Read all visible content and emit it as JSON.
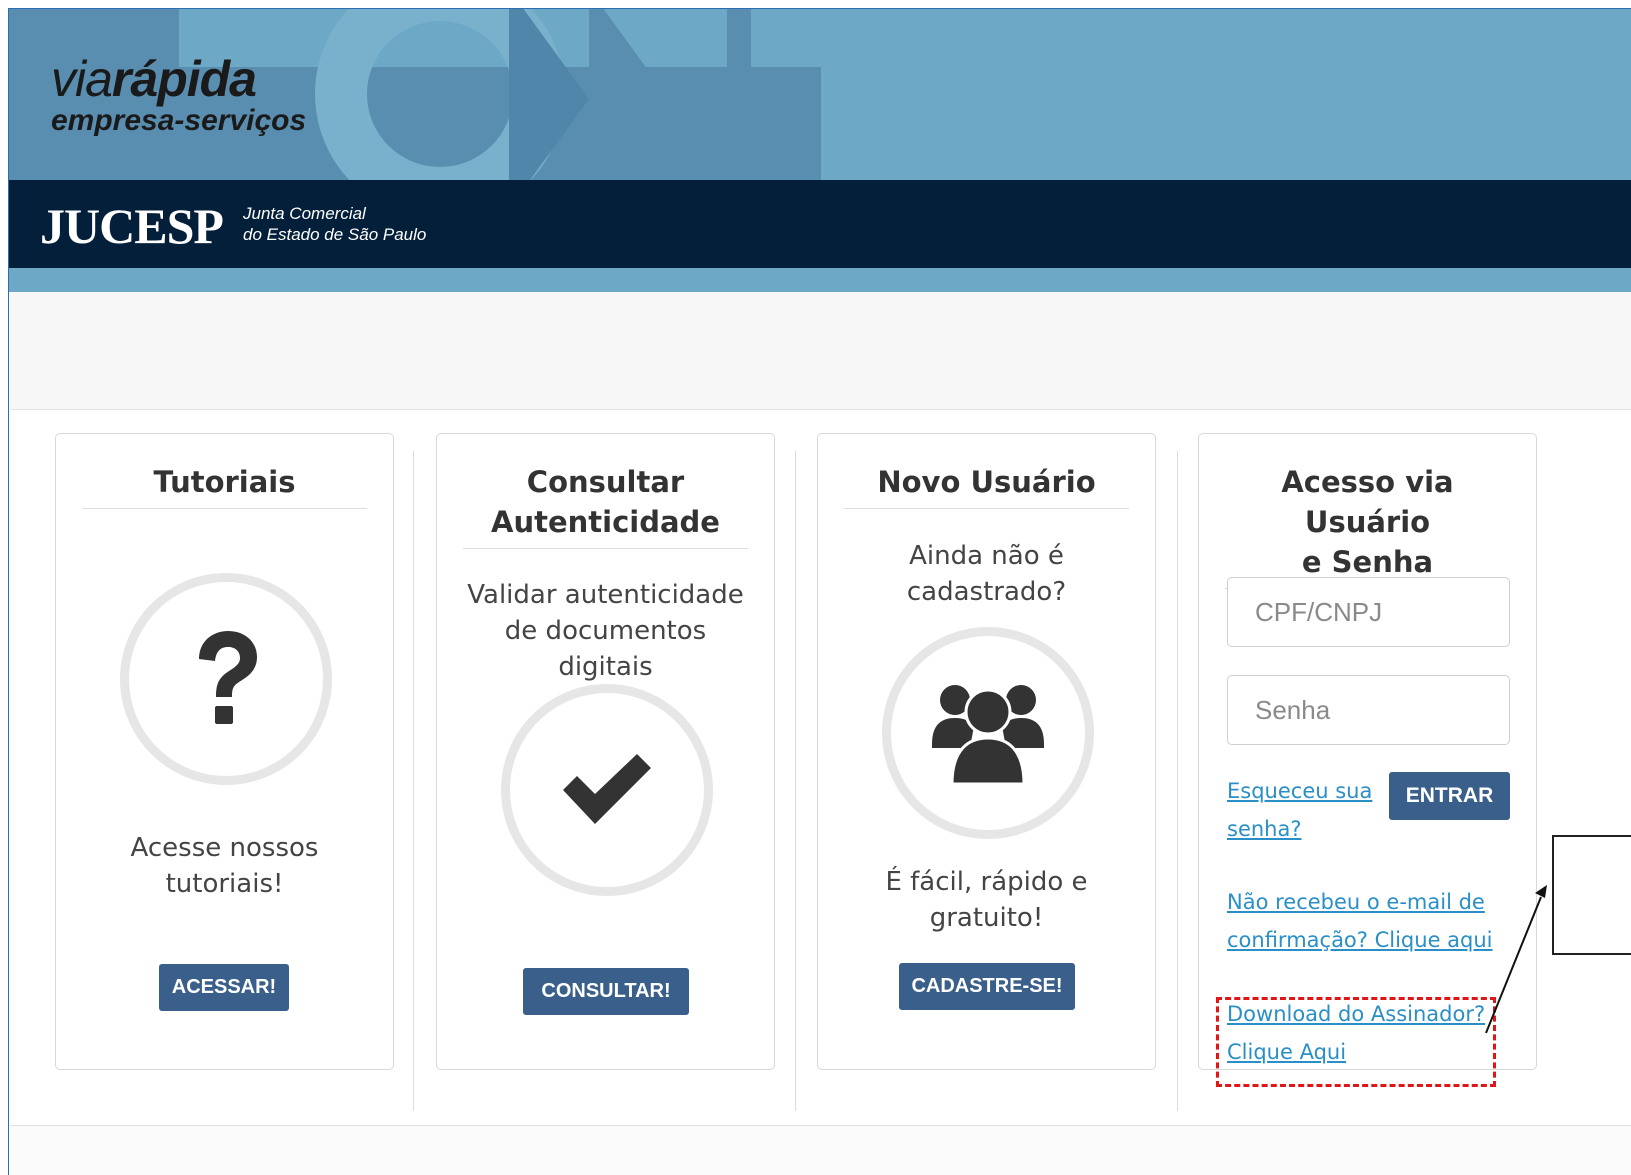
{
  "header": {
    "brand_via": "via",
    "brand_rapida": "rápida",
    "brand_sub": "empresa-serviços",
    "org_logo": "JUCESP",
    "org_line1": "Junta Comercial",
    "org_line2": "do Estado de São Paulo"
  },
  "cards": {
    "tutoriais": {
      "title": "Tutoriais",
      "icon": "question-icon",
      "text_line1": "Acesse nossos",
      "text_line2": "tutoriais!",
      "button": "ACESSAR!"
    },
    "consultar": {
      "title_line1": "Consultar",
      "title_line2": "Autenticidade",
      "text_line1": "Validar autenticidade",
      "text_line2": "de documentos",
      "text_line3": "digitais",
      "icon": "check-icon",
      "button": "CONSULTAR!"
    },
    "novo_usuario": {
      "title": "Novo Usuário",
      "question_line1": "Ainda não é",
      "question_line2": "cadastrado?",
      "icon": "users-icon",
      "text_line1": "É fácil, rápido e",
      "text_line2": "gratuito!",
      "button": "CADASTRE-SE!"
    },
    "login": {
      "title_line1": "Acesso via Usuário",
      "title_line2": "e Senha",
      "cpf_placeholder": "CPF/CNPJ",
      "senha_placeholder": "Senha",
      "forgot_line1": "Esqueceu sua",
      "forgot_line2": "senha?",
      "enter_button": "ENTRAR",
      "resend_line1": "Não recebeu o e-mail de",
      "resend_line2": "confirmação? Clique aqui",
      "download_line1": "Download do Assinador?",
      "download_line2": "Clique Aqui"
    }
  },
  "colors": {
    "header_bg": "#6da8c6",
    "jucesp_bar": "#041f3a",
    "button_bg": "#3a5f8a",
    "link": "#2a8fc7",
    "highlight": "#e01616"
  }
}
